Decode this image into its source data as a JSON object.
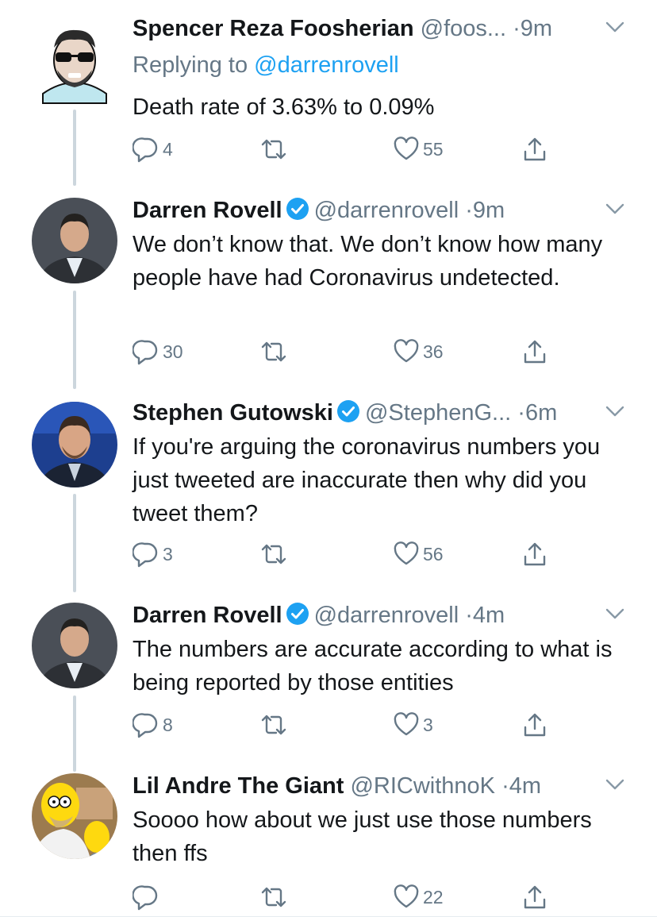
{
  "tweets": [
    {
      "name": "Spencer Reza Foosherian",
      "handle": "@foos...",
      "dot": "·",
      "time": "9m",
      "verified": false,
      "replying_prefix": "Replying to ",
      "replying_handle": "@darrenrovell",
      "text": "Death rate of 3.63% to 0.09%",
      "replies": "4",
      "retweets": "",
      "likes": "55"
    },
    {
      "name": "Darren Rovell",
      "handle": "@darrenrovell",
      "dot": "·",
      "time": "9m",
      "verified": true,
      "text": "We don’t know that. We don’t know how many people have had Coronavirus undetected.",
      "replies": "30",
      "retweets": "",
      "likes": "36"
    },
    {
      "name": "Stephen Gutowski",
      "handle": "@StephenG...",
      "dot": "·",
      "time": "6m",
      "verified": true,
      "text": "If you're arguing the coronavirus numbers you just tweeted are inaccurate then why did you tweet them?",
      "replies": "3",
      "retweets": "",
      "likes": "56"
    },
    {
      "name": "Darren Rovell",
      "handle": "@darrenrovell",
      "dot": "·",
      "time": "4m",
      "verified": true,
      "text": "The numbers are accurate according to what is being reported by those entities",
      "replies": "8",
      "retweets": "",
      "likes": "3"
    },
    {
      "name": "Lil Andre The Giant",
      "handle": "@RICwithnoK",
      "dot": "·",
      "time": "4m",
      "verified": false,
      "text": "Soooo how about we just use those numbers then ffs",
      "replies": "",
      "retweets": "",
      "likes": "22"
    }
  ],
  "icons": {
    "reply": "reply-icon",
    "retweet": "retweet-icon",
    "like": "heart-icon",
    "share": "share-icon",
    "verified": "verified-badge-icon",
    "caret": "chevron-down-icon"
  },
  "colors": {
    "text": "#14171a",
    "secondary": "#657786",
    "link": "#1da1f2",
    "verified": "#1da1f2",
    "thread_line": "#ccd6dd"
  }
}
